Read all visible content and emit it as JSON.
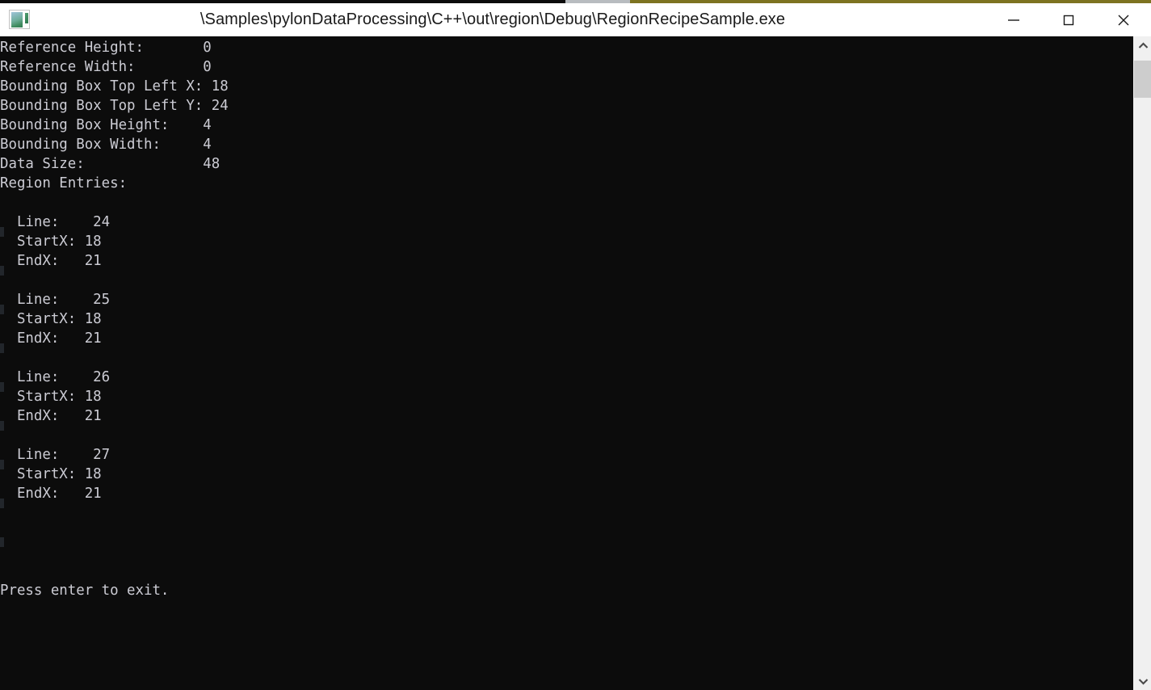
{
  "window": {
    "title": "\\Samples\\pylonDataProcessing\\C++\\out\\region\\Debug\\RegionRecipeSample.exe",
    "icon": "image-app-icon",
    "minimize_label": "Minimize",
    "maximize_label": "Maximize",
    "close_label": "Close",
    "background_color": "#0c0c0c",
    "text_color": "#ccccd4",
    "titlebar_color": "#ffffff"
  },
  "top_strip": {
    "segment_black_color": "#0c0c0c",
    "segment_gray_color": "#b8bcc0",
    "segment_olive_color": "#7d7320"
  },
  "console": {
    "output": "Reference Height:       0\nReference Width:        0\nBounding Box Top Left X: 18\nBounding Box Top Left Y: 24\nBounding Box Height:    4\nBounding Box Width:     4\nData Size:              48\nRegion Entries:\n\n  Line:    24\n  StartX: 18\n  EndX:   21\n\n  Line:    25\n  StartX: 18\n  EndX:   21\n\n  Line:    26\n  StartX: 18\n  EndX:   21\n\n  Line:    27\n  StartX: 18\n  EndX:   21\n\n\n\n\nPress enter to exit.",
    "fields": [
      {
        "label": "Reference Height:",
        "value": "0"
      },
      {
        "label": "Reference Width:",
        "value": "0"
      },
      {
        "label": "Bounding Box Top Left X:",
        "value": "18"
      },
      {
        "label": "Bounding Box Top Left Y:",
        "value": "24"
      },
      {
        "label": "Bounding Box Height:",
        "value": "4"
      },
      {
        "label": "Bounding Box Width:",
        "value": "4"
      },
      {
        "label": "Data Size:",
        "value": "48"
      }
    ],
    "region_entries_header": "Region Entries:",
    "region_entries": [
      {
        "line": "24",
        "startx": "18",
        "endx": "21"
      },
      {
        "line": "25",
        "startx": "18",
        "endx": "21"
      },
      {
        "line": "26",
        "startx": "18",
        "endx": "21"
      },
      {
        "line": "27",
        "startx": "18",
        "endx": "21"
      }
    ],
    "entry_labels": {
      "line": "Line:",
      "startx": "StartX:",
      "endx": "EndX:"
    },
    "prompt": "Press enter to exit."
  },
  "scrollbar": {
    "up_arrow": "chevron-up-icon",
    "down_arrow": "chevron-down-icon",
    "track_color": "#f0f0f0",
    "thumb_color": "#cdcdcd"
  }
}
